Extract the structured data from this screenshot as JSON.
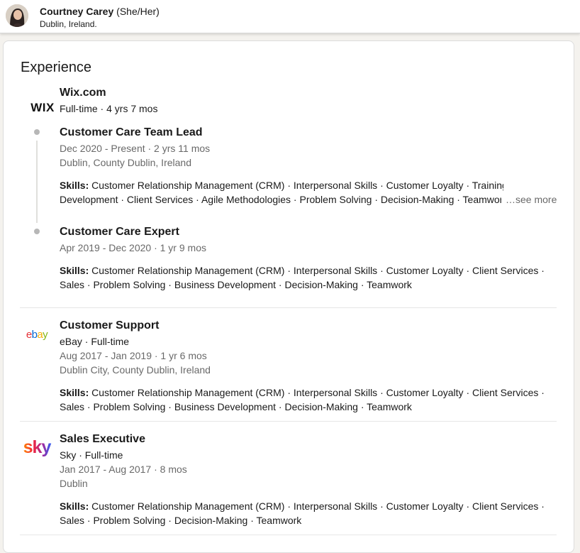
{
  "profile": {
    "name": "Courtney Carey",
    "pronouns": "(She/Her)",
    "location": "Dublin, Ireland."
  },
  "experience": {
    "title": "Experience",
    "skills_label": "Skills:",
    "see_more": "…see more",
    "companies": [
      {
        "name": "Wix.com",
        "logo_text": "WIX",
        "meta": "Full-time · 4 yrs 7 mos",
        "roles": [
          {
            "title": "Customer Care Team Lead",
            "dates": "Dec 2020 - Present · 2 yrs 11 mos",
            "location": "Dublin, County Dublin, Ireland",
            "skills_line1": "Customer Relationship Management (CRM) · Interpersonal Skills · Customer Loyalty · Training &",
            "skills_line2": "Development · Client Services · Agile Methodologies · Problem Solving · Decision-Making · Teamwork"
          },
          {
            "title": "Customer Care Expert",
            "dates": "Apr 2019 - Dec 2020 · 1 yr 9 mos",
            "skills_line1": "Customer Relationship Management (CRM) · Interpersonal Skills · Customer Loyalty · Client Services ·",
            "skills_line2": "Sales · Problem Solving · Business Development · Decision-Making · Teamwork"
          }
        ]
      },
      {
        "title": "Customer Support",
        "logo_text": "ebay",
        "meta": "eBay · Full-time",
        "dates": "Aug 2017 - Jan 2019 · 1 yr 6 mos",
        "location": "Dublin City, County Dublin, Ireland",
        "skills_line1": "Customer Relationship Management (CRM) · Interpersonal Skills · Customer Loyalty · Client Services ·",
        "skills_line2": "Sales · Problem Solving · Business Development · Decision-Making · Teamwork"
      },
      {
        "title": "Sales Executive",
        "logo_text": "sky",
        "meta": "Sky · Full-time",
        "dates": "Jan 2017 - Aug 2017 · 8 mos",
        "location": "Dublin",
        "skills_line1": "Customer Relationship Management (CRM) · Interpersonal Skills · Customer Loyalty · Client Services ·",
        "skills_line2": "Sales · Problem Solving · Decision-Making · Teamwork"
      }
    ]
  },
  "colors": {
    "ebay_e": "#e53238",
    "ebay_b": "#0064d2",
    "ebay_a": "#f5af02",
    "ebay_y": "#86b817"
  }
}
